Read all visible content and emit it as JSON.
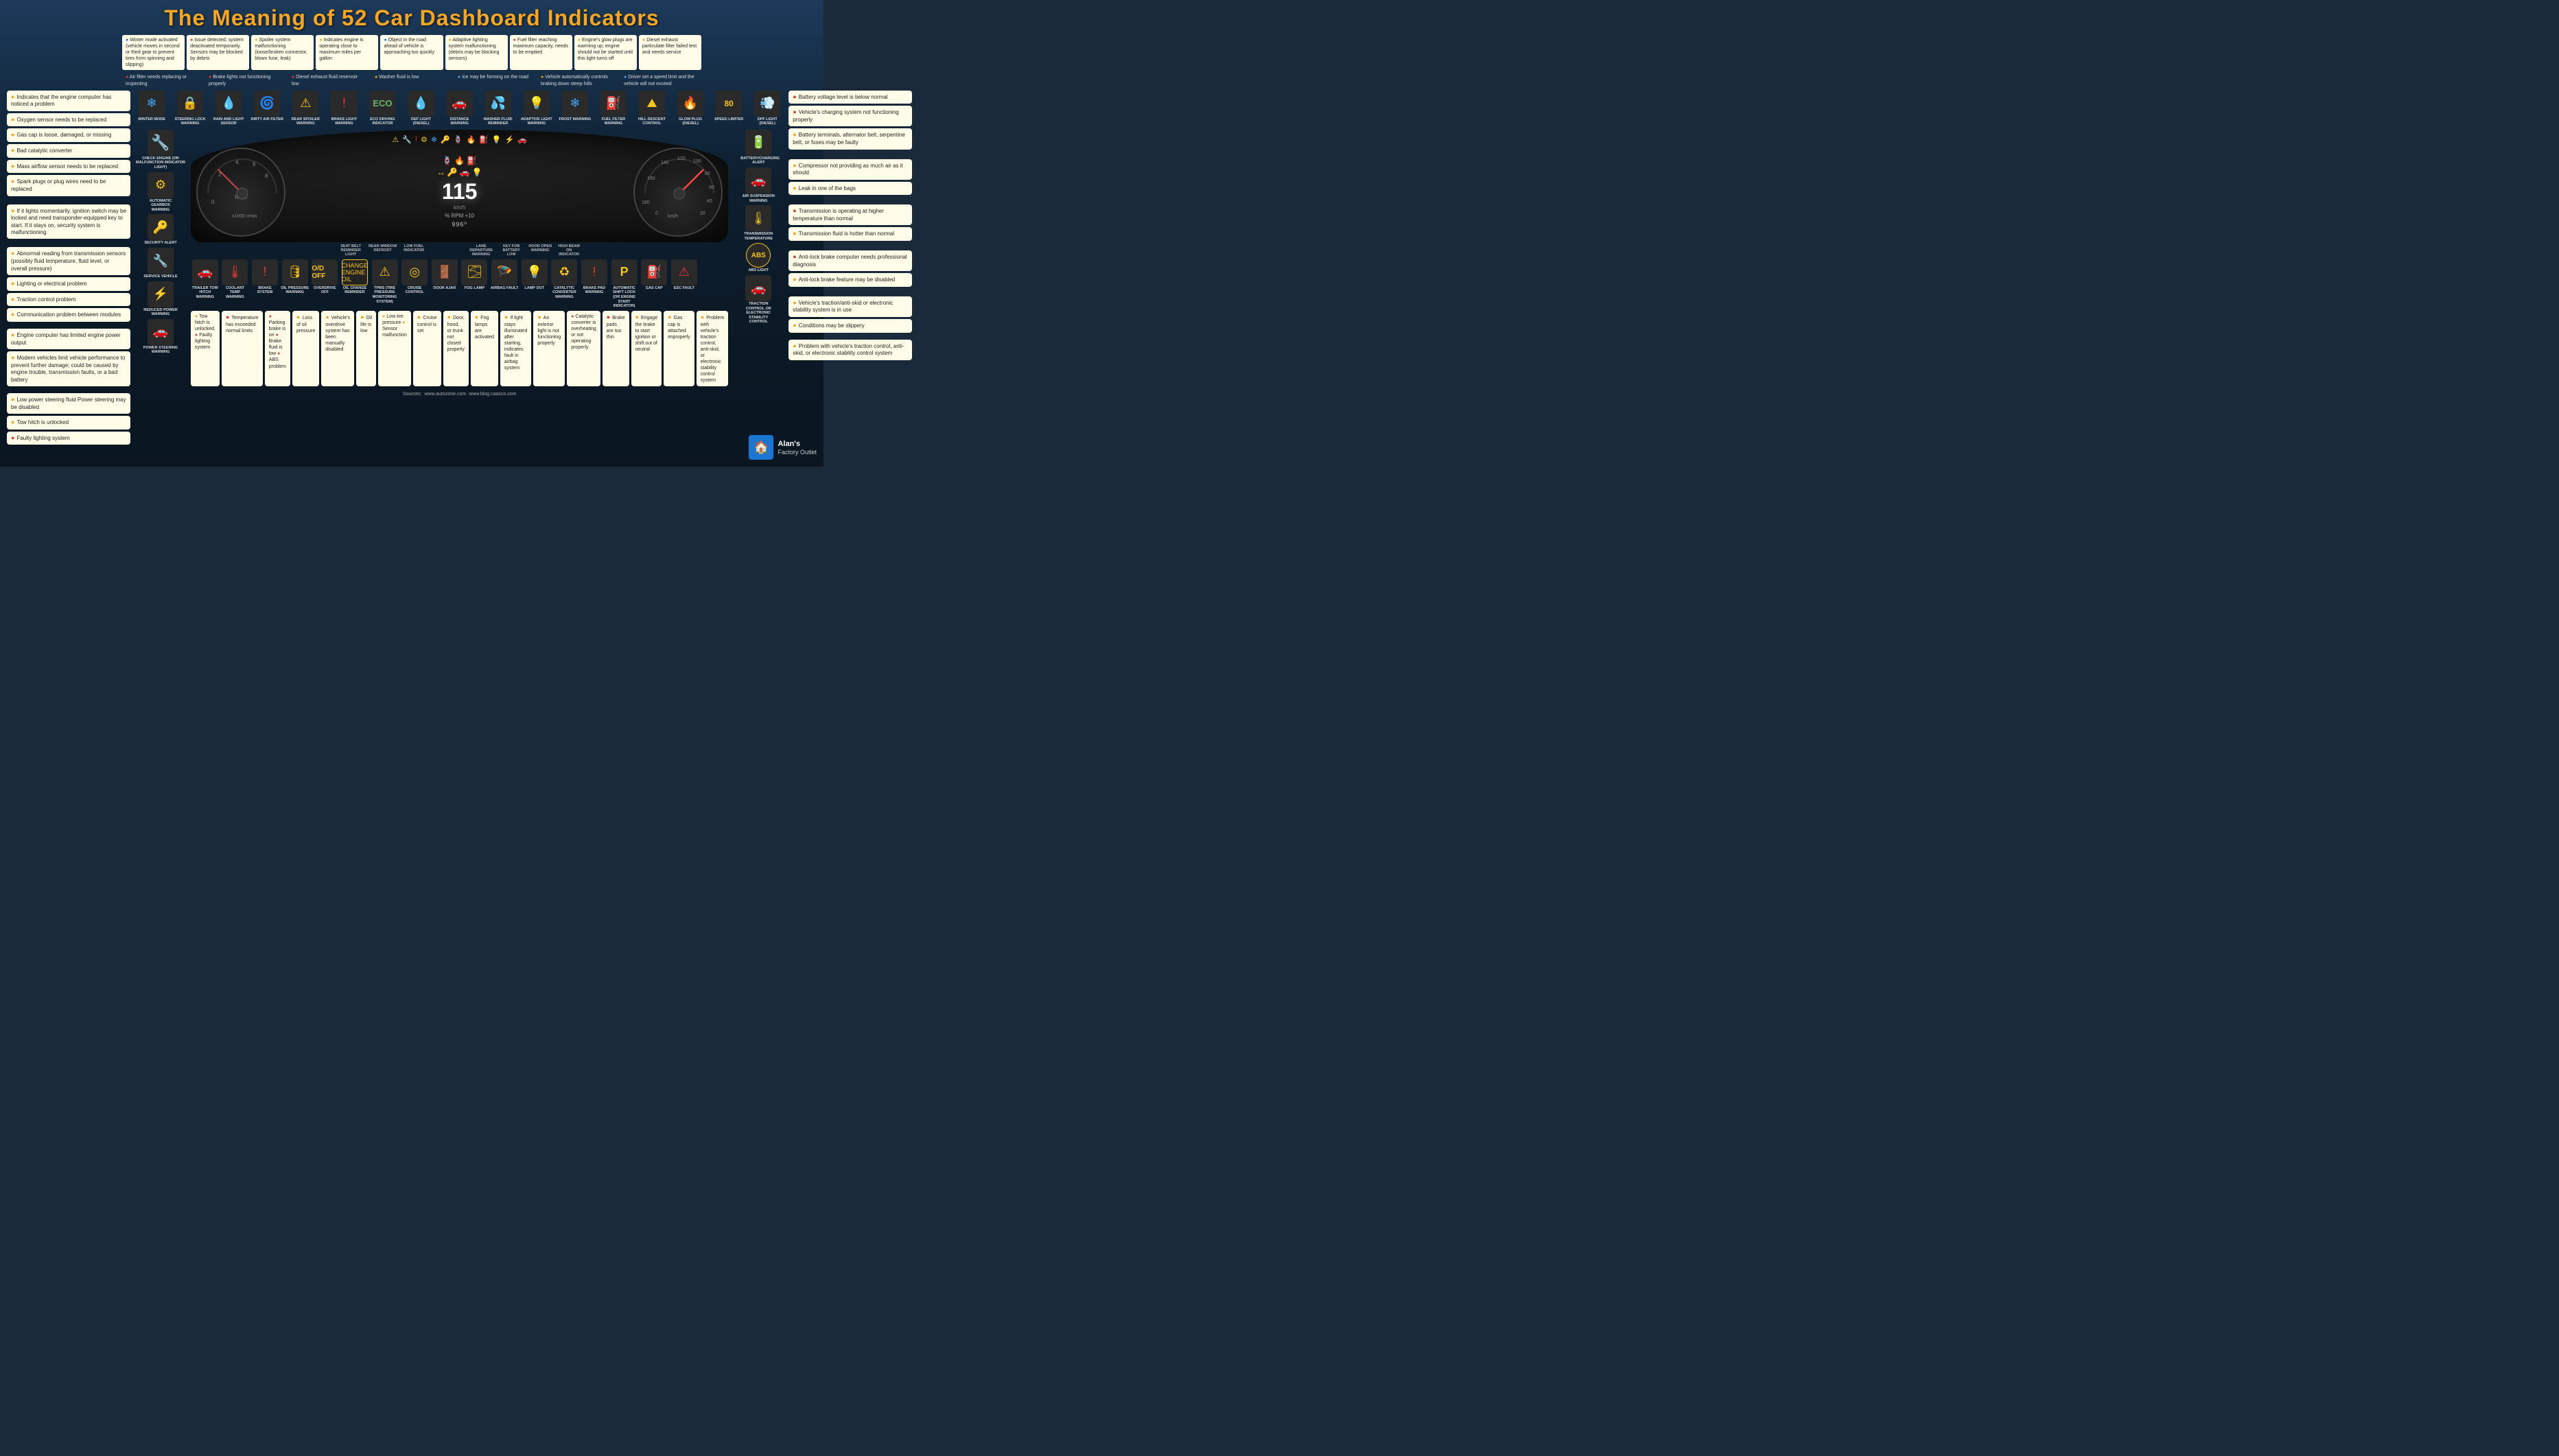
{
  "title": {
    "prefix": "The Meaning of ",
    "number": "52",
    "suffix": " Car Dashboard Indicators"
  },
  "left_notes": [
    {
      "text": "Indicates that the engine computer has noticed a problem",
      "dot": "yellow"
    },
    {
      "text": "Oxygen sensor needs to be replaced",
      "dot": "yellow"
    },
    {
      "text": "Gas cap is loose, damaged, or missing",
      "dot": "yellow"
    },
    {
      "text": "Bad catalytic converter",
      "dot": "yellow"
    },
    {
      "text": "Mass airflow sensor needs to be replaced",
      "dot": "yellow"
    },
    {
      "text": "Spark plugs or plug wires need to be replaced",
      "dot": "yellow"
    },
    {
      "text": "If it lights momentarily, ignition switch may be locked and need transponder-equipped key to start",
      "dot": "yellow"
    },
    {
      "text": "If it stays on, security system is malfunctioning",
      "dot": "yellow"
    },
    {
      "text": "Engine computer has limited engine power output",
      "dot": "yellow"
    },
    {
      "text": "Modern vehicles limit vehicle performance to prevent further damage; could be caused by engine trouble, transmission faults, or a bad battery",
      "dot": "yellow"
    },
    {
      "text": "Low power steering fluid Power steering may be disabled",
      "dot": "yellow"
    },
    {
      "text": "Tow hitch is unlocked",
      "dot": "yellow"
    },
    {
      "text": "Faulty lighting system",
      "dot": "red"
    }
  ],
  "right_notes": [
    {
      "text": "Battery voltage level is below normal",
      "dot": "red"
    },
    {
      "text": "Vehicle's charging system not functioning properly",
      "dot": "red"
    },
    {
      "text": "Battery terminals, alternator belt, serpentine belt, or fuses may be faulty",
      "dot": "yellow"
    },
    {
      "text": "Compressor not providing as much air as it should",
      "dot": "yellow"
    },
    {
      "text": "Leak in one of the bags",
      "dot": "yellow"
    },
    {
      "text": "Transmission is operating at higher temperature than normal",
      "dot": "red"
    },
    {
      "text": "Transmission fluid is hotter than normal",
      "dot": "yellow"
    },
    {
      "text": "Anti-lock brake feature may be disabled",
      "dot": "yellow"
    },
    {
      "text": "Anti-lock brake computer needs professional diagnosis",
      "dot": "red"
    },
    {
      "text": "Vehicle's traction/anti-skid or electronic stability system is in use",
      "dot": "yellow"
    },
    {
      "text": "Conditions may be slippery",
      "dot": "yellow"
    },
    {
      "text": "Problem with vehicle's traction control, anti-skid, or electronic stability control system",
      "dot": "yellow"
    }
  ],
  "top_indicators": [
    {
      "label": "WINTER MODE",
      "icon": "❄️",
      "color": "blue"
    },
    {
      "label": "STEERING LOCK WARNING",
      "icon": "🔒",
      "color": "yellow"
    },
    {
      "label": "RAIN AND LIGHT SENSOR",
      "icon": "💧",
      "color": "yellow"
    },
    {
      "label": "DIRTY AIR FILTER",
      "icon": "🌀",
      "color": "yellow"
    },
    {
      "label": "REAR SPOILER WARNING",
      "icon": "🚗",
      "color": "yellow"
    },
    {
      "label": "BRAKE LIGHT WARNING",
      "icon": "!",
      "color": "red"
    },
    {
      "label": "ECO DRIVING INDICATOR",
      "icon": "🌿",
      "color": "green"
    },
    {
      "label": "DEF LIGHT (Diesel)",
      "icon": "💧",
      "color": "yellow"
    },
    {
      "label": "DISTANCE WARNING",
      "icon": "🚗",
      "color": "yellow"
    },
    {
      "label": "WASHER FLUID REMINDER",
      "icon": "💦",
      "color": "yellow"
    },
    {
      "label": "ADAPTIVE LIGHT WARNING",
      "icon": "💡",
      "color": "yellow"
    },
    {
      "label": "FROST WARNING",
      "icon": "❄️",
      "color": "yellow"
    },
    {
      "label": "FUEL FILTER WARNING",
      "icon": "⛽",
      "color": "yellow"
    },
    {
      "label": "HILL DESCENT CONTROL",
      "icon": "⛰️",
      "color": "yellow"
    },
    {
      "label": "GLOW PLUG (Diesel)",
      "icon": "🔥",
      "color": "yellow"
    },
    {
      "label": "SPEED LIMITER",
      "icon": "🔢",
      "color": "yellow"
    },
    {
      "label": "DPF LIGHT (Diesel)",
      "icon": "💨",
      "color": "yellow"
    }
  ],
  "mid_left_indicators": [
    {
      "label": "CHECK ENGINE",
      "icon": "🔧",
      "color": "yellow"
    },
    {
      "label": "AUTOMATIC GEARBOX WARNING",
      "icon": "⚙️",
      "color": "yellow"
    },
    {
      "label": "SECURITY ALERT",
      "icon": "🔑",
      "color": "yellow"
    },
    {
      "label": "SERVICE VEHICLE",
      "icon": "🔧",
      "color": "yellow"
    },
    {
      "label": "REDUCED POWER WARNING",
      "icon": "⚡",
      "color": "red"
    },
    {
      "label": "POWER STEERING WARNING LIGHT",
      "icon": "🚗",
      "color": "yellow"
    }
  ],
  "mid_right_indicators": [
    {
      "label": "BATTERY/CHARGING ALERT",
      "icon": "🔋",
      "color": "yellow"
    },
    {
      "label": "AIR SUSPENSION WARNING",
      "icon": "🚗",
      "color": "yellow"
    },
    {
      "label": "TRANSMISSION TEMPERATURE",
      "icon": "🌡️",
      "color": "yellow"
    },
    {
      "label": "ABS LIGHT",
      "icon": "ABS",
      "color": "yellow"
    },
    {
      "label": "TRACTION CONTROL OR ELECTRONIC STABILITY CONTROL",
      "icon": "🚗",
      "color": "yellow"
    },
    {
      "label": "AUTOMATIC SHIFT LOCK (or Engine Start Indicator)",
      "icon": "P",
      "color": "yellow"
    },
    {
      "label": "GAS CAP",
      "icon": "⛽",
      "color": "yellow"
    },
    {
      "label": "ESC FAULT",
      "icon": "⚠️",
      "color": "yellow"
    }
  ],
  "bottom_indicators": [
    {
      "label": "TRAILER TOW HITCH WARNING",
      "icon": "🚗",
      "color": "yellow"
    },
    {
      "label": "COOLANT TEMP WARNING",
      "icon": "🌡️",
      "color": "red"
    },
    {
      "label": "BRAKE SYSTEM",
      "icon": "!",
      "color": "red"
    },
    {
      "label": "OIL PRESSURE WARNING",
      "icon": "🛢️",
      "color": "yellow"
    },
    {
      "label": "OVERDRIVE OFF",
      "icon": "O/D",
      "color": "yellow"
    },
    {
      "label": "CHANGE ENGINE OIL",
      "icon": "🛢️",
      "color": "yellow"
    },
    {
      "label": "OIL CHANGE REMINDER",
      "icon": "🔄",
      "color": "yellow"
    },
    {
      "label": "TPMS",
      "icon": "⚠️",
      "color": "yellow"
    },
    {
      "label": "CRUISE CONTROL",
      "icon": "◎",
      "color": "yellow"
    },
    {
      "label": "DOOR AJAR",
      "icon": "🚪",
      "color": "yellow"
    },
    {
      "label": "FOG LAMP",
      "icon": "🌫️",
      "color": "yellow"
    },
    {
      "label": "AIRBAG FAULT",
      "icon": "🪂",
      "color": "yellow"
    },
    {
      "label": "LAMP OUT",
      "icon": "💡",
      "color": "yellow"
    },
    {
      "label": "CATALYTIC CONVERTER WARNING",
      "icon": "♻️",
      "color": "yellow"
    },
    {
      "label": "BRAKE PAD WARNING",
      "icon": "!",
      "color": "red"
    },
    {
      "label": "AUTOMATIC SHIFT LOCK",
      "icon": "P",
      "color": "yellow"
    },
    {
      "label": "GAS CAP",
      "icon": "⛽",
      "color": "yellow"
    },
    {
      "label": "ESC FAULT",
      "icon": "⚠️",
      "color": "yellow"
    }
  ],
  "bottom_notes_left": [
    {
      "text": "Temperature has exceeded normal limits",
      "dot": "red"
    },
    {
      "text": "Parking brake is on",
      "dot": "red"
    },
    {
      "text": "Brake fluid is low",
      "dot": "red"
    },
    {
      "text": "ABS problem",
      "dot": "red"
    }
  ],
  "bottom_notes_right": [
    {
      "text": "Gas cap is attached improperly",
      "dot": "yellow"
    },
    {
      "text": "Engage the brake to start ignition or shift out of neutral",
      "dot": "yellow"
    },
    {
      "text": "Brake pads are too thin",
      "dot": "red"
    },
    {
      "text": "Catalytic converter is overheating or not operating properly",
      "dot": "red"
    },
    {
      "text": "An exterior light is not functioning properly",
      "dot": "yellow"
    }
  ],
  "sources": {
    "label": "Sources:",
    "items": [
      "www.autozone.com",
      "www.blog.caasco.com"
    ]
  },
  "logo": {
    "name": "Alan's",
    "sub": "Factory Outlet"
  },
  "dashboard_center_notes": [
    {
      "label": "SEAT BELT REMINDER LIGHT",
      "icon": "🪢",
      "color": "red"
    },
    {
      "label": "REAR WINDOW DEFROST",
      "icon": "🔥",
      "color": "yellow"
    },
    {
      "label": "LOW FUEL INDICATOR",
      "icon": "⛽",
      "color": "yellow"
    },
    {
      "label": "LANE DEPARTURE WARNING",
      "icon": "🚗",
      "color": "yellow"
    },
    {
      "label": "KEY FOB BATTERY LOW",
      "icon": "🔑",
      "color": "yellow"
    },
    {
      "label": "HOOD OPEN WARNING",
      "icon": "🚗",
      "color": "yellow"
    },
    {
      "label": "HIGH BEAM ON INDICATOR",
      "icon": "💡",
      "color": "blue"
    }
  ]
}
